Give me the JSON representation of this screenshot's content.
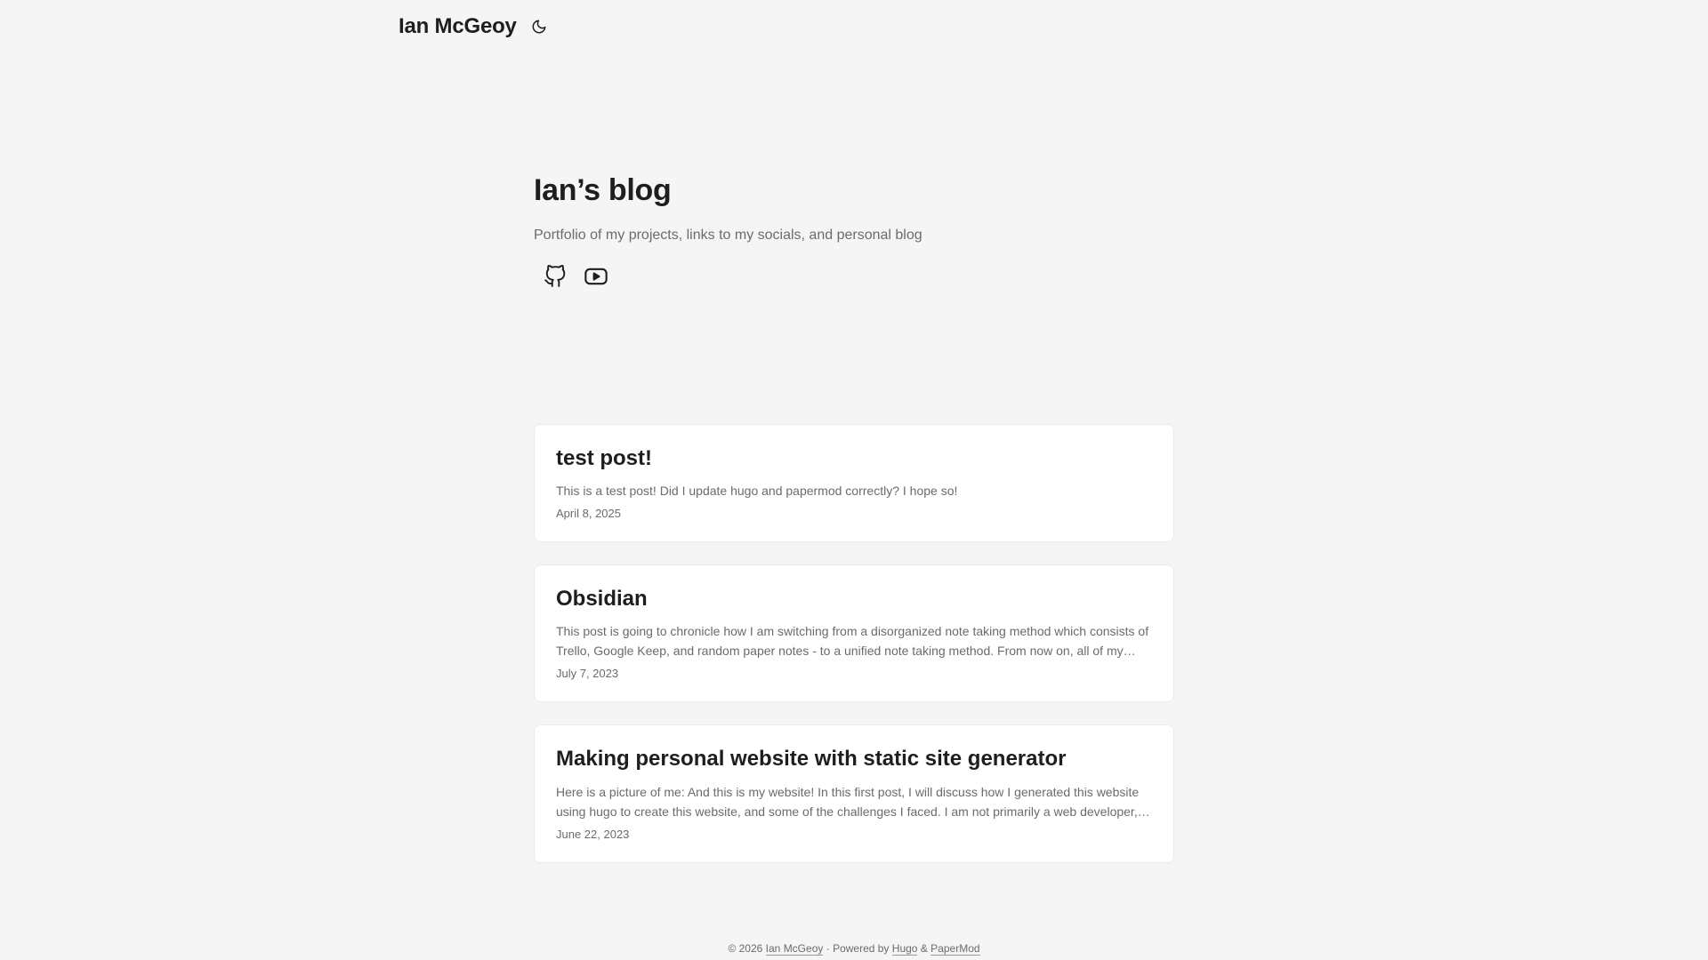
{
  "header": {
    "site_title": "Ian McGeoy",
    "theme_toggle_icon": "moon-icon"
  },
  "hero": {
    "title": "Ian’s blog",
    "description": "Portfolio of my projects, links to my socials, and personal blog",
    "socials": [
      {
        "name": "github-icon"
      },
      {
        "name": "youtube-icon"
      }
    ]
  },
  "posts": [
    {
      "title": "test post!",
      "excerpt": "This is a test post! Did I update hugo and papermod correctly? I hope so!",
      "date": "April 8, 2025"
    },
    {
      "title": "Obsidian",
      "excerpt": "This post is going to chronicle how I am switching from a disorganized note taking method which consists of Trello, Google Keep, and random paper notes - to a unified note taking method. From now on, all of my notes will be in Obsidian.",
      "date": "July 7, 2023"
    },
    {
      "title": "Making personal website with static site generator",
      "excerpt": "Here is a picture of me: And this is my website! In this first post, I will discuss how I generated this website using hugo to create this website, and some of the challenges I faced. I am not primarily a web developer, so this was a learning experience.",
      "date": "June 22, 2023"
    }
  ],
  "footer": {
    "copyright": "© 2026",
    "author_link": "Ian McGeoy",
    "separator": "·",
    "powered_by": "Powered by",
    "hugo_link": "Hugo",
    "amp": "&",
    "papermod_link": "PaperMod"
  }
}
